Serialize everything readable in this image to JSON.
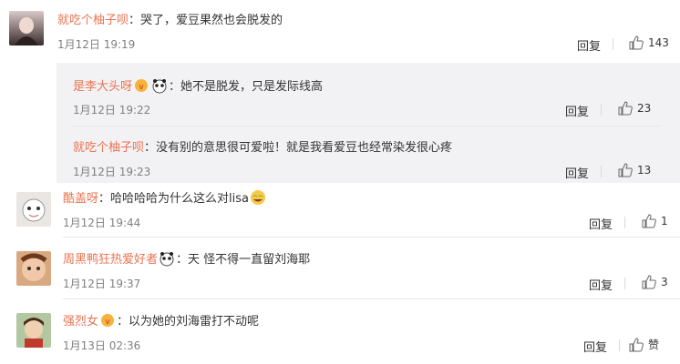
{
  "comments": [
    {
      "name": "就吃个柚子呗",
      "text": "：哭了，爱豆果然也会脱发的",
      "time": "1月12日 19:19",
      "reply": "回复",
      "likes": "143"
    },
    {
      "name": "酷盖呀",
      "text": "：哈哈哈哈为什么这么对lisa",
      "time": "1月12日 19:44",
      "reply": "回复",
      "likes": "1"
    },
    {
      "name": "周黑鸭狂热爱好者",
      "text": "：天 怪不得一直留刘海耶",
      "time": "1月12日 19:37",
      "reply": "回复",
      "likes": "3"
    },
    {
      "name": "强烈女",
      "text": "：以为她的刘海雷打不动呢",
      "time": "1月13日 02:36",
      "reply": "回复",
      "likes": "赞"
    }
  ],
  "replies": [
    {
      "name": "是李大头呀",
      "text": "：她不是脱发，只是发际线高",
      "time": "1月12日 19:22",
      "reply": "回复",
      "likes": "23"
    },
    {
      "name": "就吃个柚子呗",
      "text": "：没有别的意思很可爱啦！就是我看爱豆也经常染发很心疼",
      "time": "1月12日 19:23",
      "reply": "回复",
      "likes": "13"
    }
  ],
  "colors": {
    "name": "#eb7350",
    "panel": "#f2f2f5"
  }
}
